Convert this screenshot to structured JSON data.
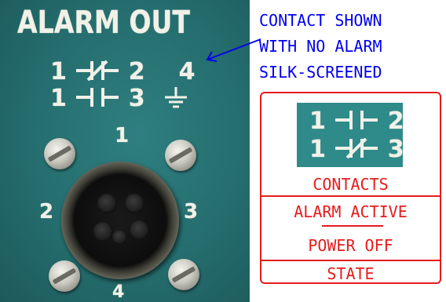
{
  "panel": {
    "title": "ALARM OUT",
    "symbol_row_1": {
      "left": "1",
      "right": "2",
      "extra": "4"
    },
    "symbol_row_2": {
      "left": "1",
      "right": "3"
    },
    "pin_labels": {
      "top": "1",
      "left": "2",
      "right": "3",
      "bottom": "4"
    },
    "icons": [
      "contact-closed-icon",
      "contact-open-icon",
      "ground-icon",
      "screw-icon",
      "connector-icon"
    ]
  },
  "annotation": {
    "lines": [
      "CONTACT SHOWN",
      "WITH NO ALARM",
      "SILK-SCREENED"
    ],
    "color": "#0000ee"
  },
  "legend": {
    "symbol_row_1": {
      "left": "1",
      "right": "2"
    },
    "symbol_row_2": {
      "left": "1",
      "right": "3"
    },
    "contacts_label": "CONTACTS",
    "state_1": "ALARM ACTIVE",
    "state_2": "POWER OFF",
    "state_label": "STATE",
    "color": "#e61c1c"
  },
  "colors": {
    "panel": "#2a7475",
    "silkscreen": "#f1f1e8"
  }
}
